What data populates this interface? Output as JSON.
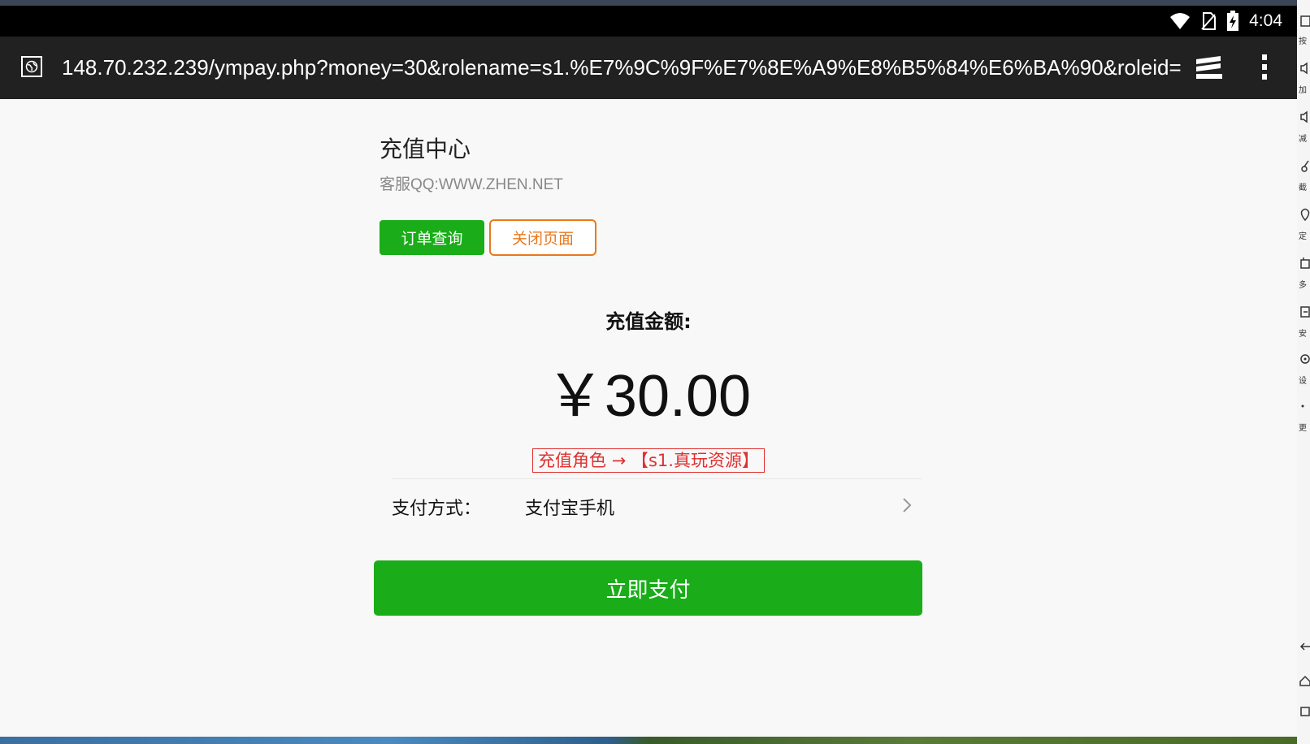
{
  "status_bar": {
    "time": "4:04"
  },
  "browser": {
    "url": "148.70.232.239/ympay.php?money=30&rolename=s1.%E7%9C%9F%E7%8E%A9%E8%B5%84%E6%BA%90&roleid="
  },
  "page": {
    "title": "充值中心",
    "service_contact": "客服QQ:WWW.ZHEN.NET",
    "buttons": {
      "order_query": "订单查询",
      "close_page": "关闭页面"
    },
    "amount_label": "充值金额:",
    "amount": "￥30.00",
    "role_text": "充值角色 → 【s1.真玩资源】",
    "payment_method_label": "支付方式：",
    "payment_method_value": "支付宝手机",
    "pay_button": "立即支付"
  },
  "colors": {
    "primary_green": "#1aad19",
    "close_orange": "#e8791e",
    "role_red": "#e03030"
  },
  "side_toolbar": {
    "labels": [
      "按",
      "加",
      "减",
      "截",
      "定",
      "多",
      "安",
      "设",
      "更"
    ]
  }
}
